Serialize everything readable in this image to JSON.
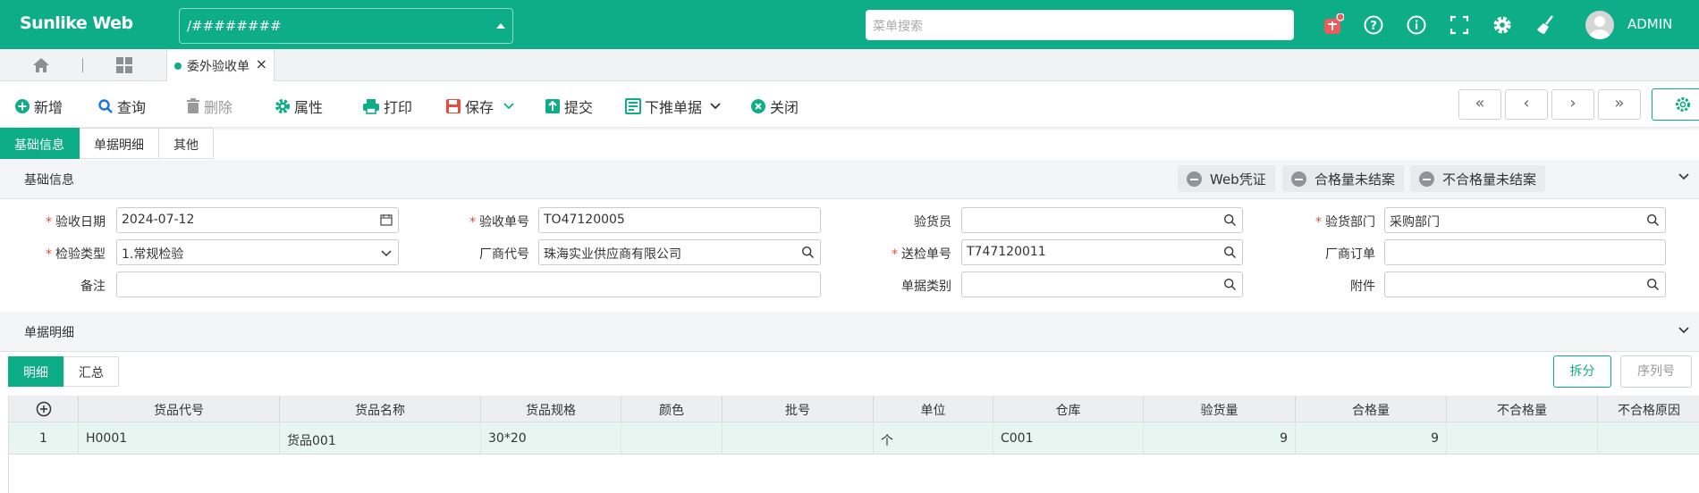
{
  "header": {
    "app_title": "Sunlike Web",
    "company_select": "/########",
    "menu_search_placeholder": "菜单搜索",
    "user": "ADMIN",
    "icons": [
      "gift-icon",
      "help-icon",
      "info-icon",
      "fullscreen-icon",
      "gear-icon",
      "broom-icon"
    ],
    "accent_color": "#0dae87"
  },
  "tabs": {
    "doc_tab": "委外验收单",
    "close": "×"
  },
  "toolbar": {
    "add": "新增",
    "query": "查询",
    "delete": "删除",
    "properties": "属性",
    "print": "打印",
    "save": "保存",
    "submit": "提交",
    "push_down": "下推单据",
    "close": "关闭"
  },
  "nav": {
    "first": "«",
    "prev": "‹",
    "next": "›",
    "last": "»"
  },
  "form_tabs": [
    "基础信息",
    "单据明细",
    "其他"
  ],
  "basic": {
    "section_title": "基础信息",
    "pills": [
      "Web凭证",
      "合格量未结案",
      "不合格量未结案"
    ],
    "fields": {
      "date_label": "验收日期",
      "date_value": "2024-07-12",
      "doc_no_label": "验收单号",
      "doc_no_value": "TO47120005",
      "inspector_label": "验货员",
      "inspector_value": "",
      "dept_label": "验货部门",
      "dept_value": "采购部门",
      "type_label": "检验类型",
      "type_value": "1.常规检验",
      "vendor_label": "厂商代号",
      "vendor_value": "珠海实业供应商有限公司",
      "send_no_label": "送检单号",
      "send_no_value": "T747120011",
      "vendor_order_label": "厂商订单",
      "vendor_order_value": "",
      "remark_label": "备注",
      "remark_value": "",
      "doc_type_label": "单据类别",
      "doc_type_value": "",
      "attach_label": "附件",
      "attach_value": ""
    }
  },
  "detail": {
    "section_title": "单据明细",
    "tabs": [
      "明细",
      "汇总"
    ],
    "split_button": "拆分",
    "serial_button": "序列号",
    "columns": [
      "货品代号",
      "货品名称",
      "货品规格",
      "颜色",
      "批号",
      "单位",
      "仓库",
      "验货量",
      "合格量",
      "不合格量",
      "不合格原因"
    ],
    "rows": [
      {
        "no": "1",
        "code": "H0001",
        "name": "货品001",
        "spec": "30*20",
        "color": "",
        "batch": "",
        "unit": "个",
        "warehouse": "C001",
        "inspect_qty": "9",
        "pass_qty": "9",
        "fail_qty": "",
        "fail_reason": ""
      }
    ]
  }
}
